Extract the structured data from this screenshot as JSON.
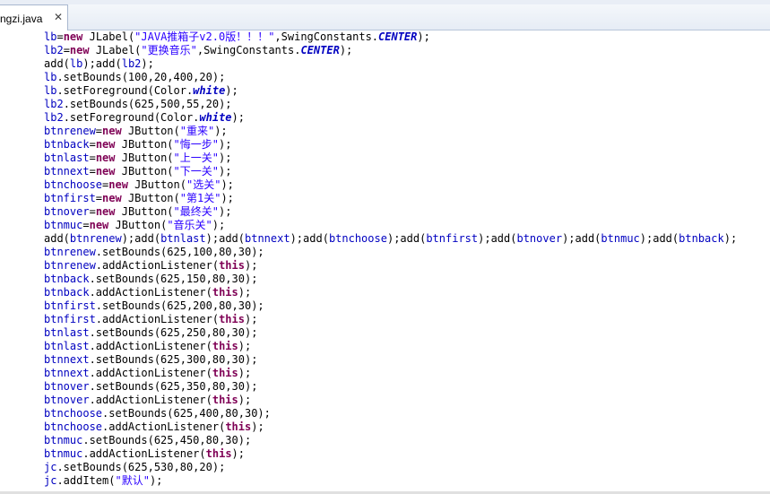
{
  "editor": {
    "tab_title": "ngzi.java",
    "tab_close": "✕",
    "lines": [
      [
        {
          "t": "lb",
          "c": "fld"
        },
        {
          "t": "="
        },
        {
          "t": "new",
          "c": "kw"
        },
        {
          "t": " JLabel("
        },
        {
          "t": "\"JAVA推箱子v2.0版！！！\"",
          "c": "str"
        },
        {
          "t": ",SwingConstants."
        },
        {
          "t": "CENTER",
          "c": "sfld"
        },
        {
          "t": ");"
        }
      ],
      [
        {
          "t": "lb2",
          "c": "fld"
        },
        {
          "t": "="
        },
        {
          "t": "new",
          "c": "kw"
        },
        {
          "t": " JLabel("
        },
        {
          "t": "\"更换音乐\"",
          "c": "str"
        },
        {
          "t": ",SwingConstants."
        },
        {
          "t": "CENTER",
          "c": "sfld"
        },
        {
          "t": ");"
        }
      ],
      [
        {
          "t": "add("
        },
        {
          "t": "lb",
          "c": "fld"
        },
        {
          "t": ");add("
        },
        {
          "t": "lb2",
          "c": "fld"
        },
        {
          "t": ");"
        }
      ],
      [
        {
          "t": "lb",
          "c": "fld"
        },
        {
          "t": ".setBounds(100,20,400,20);"
        }
      ],
      [
        {
          "t": "lb",
          "c": "fld"
        },
        {
          "t": ".setForeground(Color."
        },
        {
          "t": "white",
          "c": "sfld"
        },
        {
          "t": ");"
        }
      ],
      [
        {
          "t": "lb2",
          "c": "fld"
        },
        {
          "t": ".setBounds(625,500,55,20);"
        }
      ],
      [
        {
          "t": "lb2",
          "c": "fld"
        },
        {
          "t": ".setForeground(Color."
        },
        {
          "t": "white",
          "c": "sfld"
        },
        {
          "t": ");"
        }
      ],
      [
        {
          "t": "btnrenew",
          "c": "fld"
        },
        {
          "t": "="
        },
        {
          "t": "new",
          "c": "kw"
        },
        {
          "t": " JButton("
        },
        {
          "t": "\"重来\"",
          "c": "str"
        },
        {
          "t": ");"
        }
      ],
      [
        {
          "t": "btnback",
          "c": "fld"
        },
        {
          "t": "="
        },
        {
          "t": "new",
          "c": "kw"
        },
        {
          "t": " JButton("
        },
        {
          "t": "\"悔一步\"",
          "c": "str"
        },
        {
          "t": ");"
        }
      ],
      [
        {
          "t": "btnlast",
          "c": "fld"
        },
        {
          "t": "="
        },
        {
          "t": "new",
          "c": "kw"
        },
        {
          "t": " JButton("
        },
        {
          "t": "\"上一关\"",
          "c": "str"
        },
        {
          "t": ");"
        }
      ],
      [
        {
          "t": "btnnext",
          "c": "fld"
        },
        {
          "t": "="
        },
        {
          "t": "new",
          "c": "kw"
        },
        {
          "t": " JButton("
        },
        {
          "t": "\"下一关\"",
          "c": "str"
        },
        {
          "t": ");"
        }
      ],
      [
        {
          "t": "btnchoose",
          "c": "fld"
        },
        {
          "t": "="
        },
        {
          "t": "new",
          "c": "kw"
        },
        {
          "t": " JButton("
        },
        {
          "t": "\"选关\"",
          "c": "str"
        },
        {
          "t": ");"
        }
      ],
      [
        {
          "t": "btnfirst",
          "c": "fld"
        },
        {
          "t": "="
        },
        {
          "t": "new",
          "c": "kw"
        },
        {
          "t": " JButton("
        },
        {
          "t": "\"第1关\"",
          "c": "str"
        },
        {
          "t": ");"
        }
      ],
      [
        {
          "t": "btnover",
          "c": "fld"
        },
        {
          "t": "="
        },
        {
          "t": "new",
          "c": "kw"
        },
        {
          "t": " JButton("
        },
        {
          "t": "\"最终关\"",
          "c": "str"
        },
        {
          "t": ");"
        }
      ],
      [
        {
          "t": "btnmuc",
          "c": "fld"
        },
        {
          "t": "="
        },
        {
          "t": "new",
          "c": "kw"
        },
        {
          "t": " JButton("
        },
        {
          "t": "\"音乐关\"",
          "c": "str"
        },
        {
          "t": ");"
        }
      ],
      [
        {
          "t": "add("
        },
        {
          "t": "btnrenew",
          "c": "fld"
        },
        {
          "t": ");add("
        },
        {
          "t": "btnlast",
          "c": "fld"
        },
        {
          "t": ");add("
        },
        {
          "t": "btnnext",
          "c": "fld"
        },
        {
          "t": ");add("
        },
        {
          "t": "btnchoose",
          "c": "fld"
        },
        {
          "t": ");add("
        },
        {
          "t": "btnfirst",
          "c": "fld"
        },
        {
          "t": ");add("
        },
        {
          "t": "btnover",
          "c": "fld"
        },
        {
          "t": ");add("
        },
        {
          "t": "btnmuc",
          "c": "fld"
        },
        {
          "t": ");add("
        },
        {
          "t": "btnback",
          "c": "fld"
        },
        {
          "t": ");"
        }
      ],
      [
        {
          "t": "btnrenew",
          "c": "fld"
        },
        {
          "t": ".setBounds(625,100,80,30);"
        }
      ],
      [
        {
          "t": "btnrenew",
          "c": "fld"
        },
        {
          "t": ".addActionListener("
        },
        {
          "t": "this",
          "c": "kw"
        },
        {
          "t": ");"
        }
      ],
      [
        {
          "t": "btnback",
          "c": "fld"
        },
        {
          "t": ".setBounds(625,150,80,30);"
        }
      ],
      [
        {
          "t": "btnback",
          "c": "fld"
        },
        {
          "t": ".addActionListener("
        },
        {
          "t": "this",
          "c": "kw"
        },
        {
          "t": ");"
        }
      ],
      [
        {
          "t": "btnfirst",
          "c": "fld"
        },
        {
          "t": ".setBounds(625,200,80,30);"
        }
      ],
      [
        {
          "t": "btnfirst",
          "c": "fld"
        },
        {
          "t": ".addActionListener("
        },
        {
          "t": "this",
          "c": "kw"
        },
        {
          "t": ");"
        }
      ],
      [
        {
          "t": "btnlast",
          "c": "fld"
        },
        {
          "t": ".setBounds(625,250,80,30);"
        }
      ],
      [
        {
          "t": "btnlast",
          "c": "fld"
        },
        {
          "t": ".addActionListener("
        },
        {
          "t": "this",
          "c": "kw"
        },
        {
          "t": ");"
        }
      ],
      [
        {
          "t": "btnnext",
          "c": "fld"
        },
        {
          "t": ".setBounds(625,300,80,30);"
        }
      ],
      [
        {
          "t": "btnnext",
          "c": "fld"
        },
        {
          "t": ".addActionListener("
        },
        {
          "t": "this",
          "c": "kw"
        },
        {
          "t": ");"
        }
      ],
      [
        {
          "t": "btnover",
          "c": "fld"
        },
        {
          "t": ".setBounds(625,350,80,30);"
        }
      ],
      [
        {
          "t": "btnover",
          "c": "fld"
        },
        {
          "t": ".addActionListener("
        },
        {
          "t": "this",
          "c": "kw"
        },
        {
          "t": ");"
        }
      ],
      [
        {
          "t": "btnchoose",
          "c": "fld"
        },
        {
          "t": ".setBounds(625,400,80,30);"
        }
      ],
      [
        {
          "t": "btnchoose",
          "c": "fld"
        },
        {
          "t": ".addActionListener("
        },
        {
          "t": "this",
          "c": "kw"
        },
        {
          "t": ");"
        }
      ],
      [
        {
          "t": "btnmuc",
          "c": "fld"
        },
        {
          "t": ".setBounds(625,450,80,30);"
        }
      ],
      [
        {
          "t": "btnmuc",
          "c": "fld"
        },
        {
          "t": ".addActionListener("
        },
        {
          "t": "this",
          "c": "kw"
        },
        {
          "t": ");"
        }
      ],
      [
        {
          "t": "jc",
          "c": "fld"
        },
        {
          "t": ".setBounds(625,530,80,20);"
        }
      ],
      [
        {
          "t": "jc",
          "c": "fld"
        },
        {
          "t": ".addItem("
        },
        {
          "t": "\"默认\"",
          "c": "str"
        },
        {
          "t": ");"
        }
      ]
    ]
  }
}
